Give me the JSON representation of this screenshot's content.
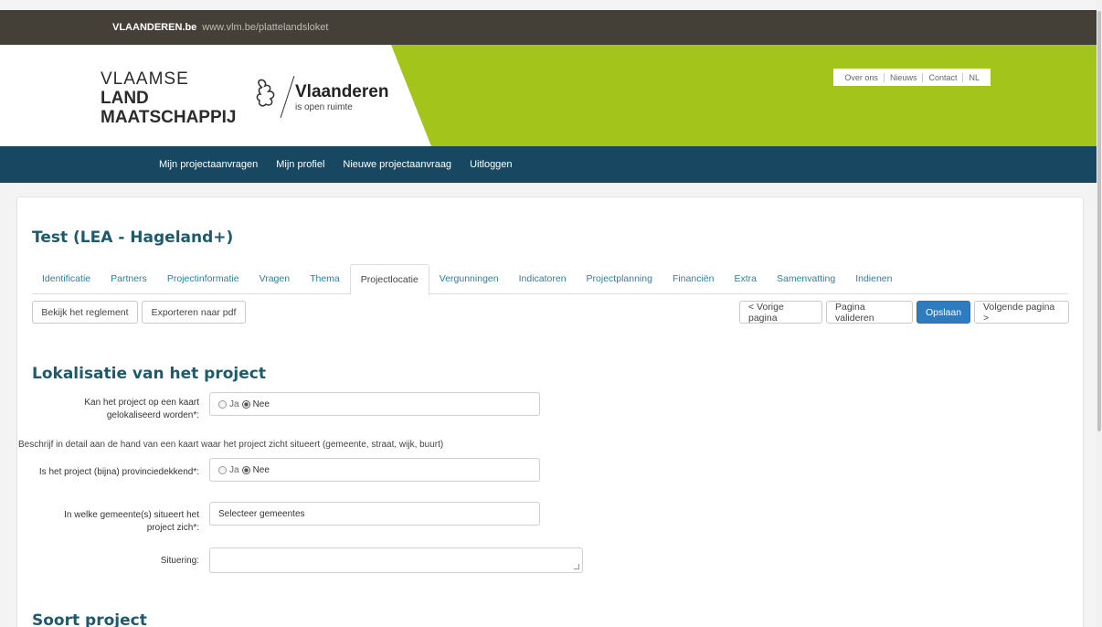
{
  "topbar": {
    "brand": "VLAANDEREN.be",
    "url": "www.vlm.be/plattelandsloket"
  },
  "logo_vlm": {
    "line1": "VLAAMSE",
    "line2": "LAND",
    "line3": "MAATSCHAPPIJ"
  },
  "logo_vlaanderen": {
    "title": "Vlaanderen",
    "tagline": "is open ruimte"
  },
  "utility_nav": [
    "Over ons",
    "Nieuws",
    "Contact",
    "NL"
  ],
  "main_nav": [
    "Mijn projectaanvragen",
    "Mijn profiel",
    "Nieuwe projectaanvraag",
    "Uitloggen"
  ],
  "project_title": "Test (LEA - Hageland+)",
  "tabs": [
    "Identificatie",
    "Partners",
    "Projectinformatie",
    "Vragen",
    "Thema",
    "Projectlocatie",
    "Vergunningen",
    "Indicatoren",
    "Projectplanning",
    "Financiën",
    "Extra",
    "Samenvatting",
    "Indienen"
  ],
  "active_tab": "Projectlocatie",
  "toolbar": {
    "reglement": "Bekijk het reglement",
    "export_pdf": "Exporteren naar pdf",
    "previous": "< Vorige pagina",
    "validate": "Pagina valideren",
    "save": "Opslaan",
    "next": "Volgende pagina >"
  },
  "section_lokalisatie": "Lokalisatie van het project",
  "fields": {
    "kaart": {
      "label": "Kan het project op een kaart gelokaliseerd worden*:",
      "options": [
        "Ja",
        "Nee"
      ],
      "selected": "Nee"
    },
    "help": "Beschrijf in detail aan de hand van een kaart waar het project zicht situeert (gemeente, straat, wijk, buurt)",
    "provincie": {
      "label": "Is het project (bijna) provinciedekkend*:",
      "options": [
        "Ja",
        "Nee"
      ],
      "selected": "Nee"
    },
    "gemeente": {
      "label": "In welke gemeente(s) situeert het project zich*:",
      "placeholder": "Selecteer gemeentes"
    },
    "situering": {
      "label": "Situering:",
      "value": ""
    }
  },
  "section_soort": "Soort project",
  "colors": {
    "topbar": "#443f37",
    "green": "#a3c41a",
    "nav": "#184861",
    "heading": "#1e5a6b",
    "primary": "#2f7bc0",
    "tab_link": "#2e7fa0"
  }
}
